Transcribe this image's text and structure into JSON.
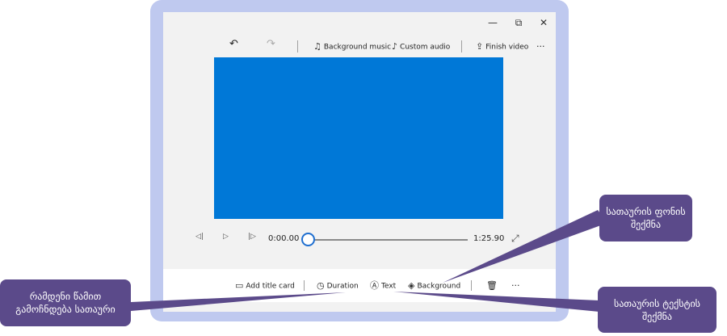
{
  "window": {
    "controls": {
      "minimize": "—",
      "maximize": "⧉",
      "close": "✕"
    }
  },
  "toolbar": {
    "undo_icon": "undo-icon",
    "redo_icon": "redo-icon",
    "background_music": "Background music",
    "custom_audio": "Custom audio",
    "finish_video": "Finish video",
    "more": "···"
  },
  "preview": {
    "color": "#0078d7"
  },
  "playback": {
    "current_time": "0:00.00",
    "total_time": "1:25.90",
    "progress": 0.0
  },
  "bottom": {
    "add_title_card": "Add title card",
    "duration": "Duration",
    "text": "Text",
    "background": "Background",
    "more": "···"
  },
  "callouts": {
    "background_callout": "სათაურის ფონის\nშექმნა",
    "duration_callout": "რამდენი წამით\nგამოჩნდება სათაური",
    "text_callout": "სათაურის ტექსტის\nშექმნა"
  },
  "colors": {
    "frame": "#bfc9ef",
    "callout": "#5b4a8a",
    "accent": "#1f6fd0"
  }
}
